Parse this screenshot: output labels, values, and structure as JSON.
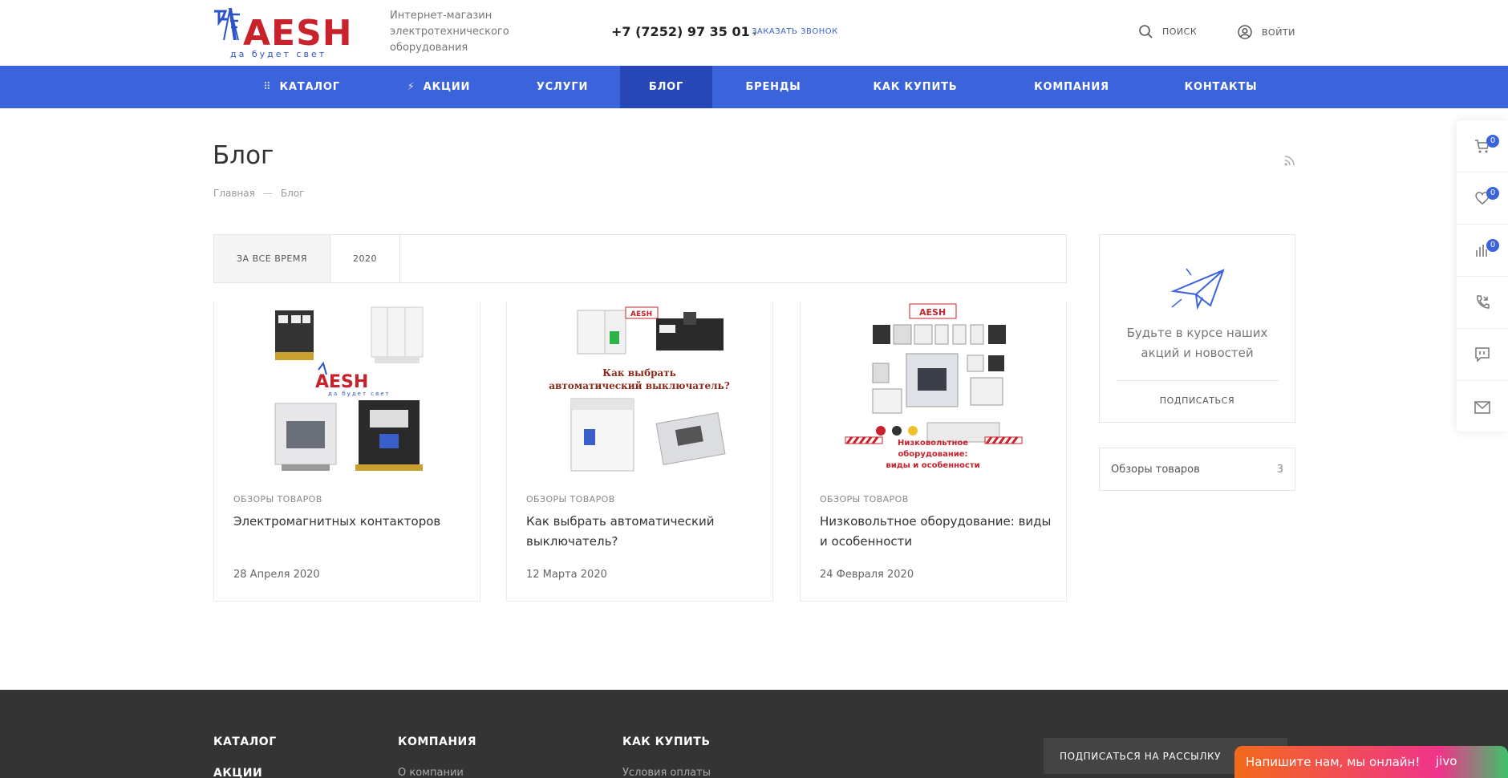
{
  "header": {
    "logo_text": "AESH",
    "logo_subtext": "да будет свет",
    "tagline": "Интернет-магазин электротехнического оборудования",
    "phone": "+7 (7252) 97 35 01",
    "callback_label": "ЗАКАЗАТЬ ЗВОНОК",
    "search_label": "ПОИСК",
    "login_label": "ВОЙТИ"
  },
  "nav": {
    "items": [
      {
        "label": "КАТАЛОГ",
        "icon": "grid-icon"
      },
      {
        "label": "АКЦИИ",
        "icon": "lightning-icon"
      },
      {
        "label": "УСЛУГИ"
      },
      {
        "label": "БЛОГ",
        "active": true
      },
      {
        "label": "БРЕНДЫ"
      },
      {
        "label": "КАК КУПИТЬ"
      },
      {
        "label": "КОМПАНИЯ"
      },
      {
        "label": "КОНТАКТЫ"
      }
    ]
  },
  "page": {
    "title": "Блог",
    "breadcrumb": [
      "Главная",
      "Блог"
    ]
  },
  "filters": {
    "items": [
      "ЗА ВСЕ ВРЕМЯ",
      "2020"
    ],
    "active": 0
  },
  "cards": [
    {
      "category": "ОБЗОРЫ ТОВАРОВ",
      "title": "Электромагнитных контакторов",
      "date": "28 Апреля 2020",
      "image_logo": "AESH",
      "image_logo_sub": "да будет свет"
    },
    {
      "category": "ОБЗОРЫ ТОВАРОВ",
      "title": "Как выбрать автоматический выключатель?",
      "date": "12 Марта 2020",
      "image_logo": "AESH",
      "image_caption_1": "Как выбрать",
      "image_caption_2": "автоматический выключатель?"
    },
    {
      "category": "ОБЗОРЫ ТОВАРОВ",
      "title": "Низковольтное оборудование: виды и особенности",
      "date": "24 Февраля 2020",
      "image_logo": "AESH",
      "image_caption_1": "Низковольтное",
      "image_caption_2": "оборудование:",
      "image_caption_3": "виды и особенности"
    }
  ],
  "sidebar": {
    "subscribe_text": "Будьте в курсе наших акций и новостей",
    "subscribe_button": "ПОДПИСАТЬСЯ",
    "categories": [
      {
        "name": "Обзоры товаров",
        "count": "3"
      }
    ]
  },
  "side_panel": {
    "cart_count": "0",
    "favorites_count": "0",
    "compare_count": "0"
  },
  "footer": {
    "col1": [
      "КАТАЛОГ",
      "АКЦИИ"
    ],
    "col2_head": "КОМПАНИЯ",
    "col2_link": "О компании",
    "col3_head": "КАК КУПИТЬ",
    "col3_link": "Условия оплаты",
    "subscribe_label": "ПОДПИСАТЬСЯ НА РАССЫЛКУ"
  },
  "chat": {
    "text": "Напишите нам, мы онлайн!",
    "brand": "jivo"
  },
  "colors": {
    "primary": "#3b63dc",
    "nav_active": "#2747b7",
    "logo_red": "#c8222c",
    "footer_bg": "#343434"
  }
}
